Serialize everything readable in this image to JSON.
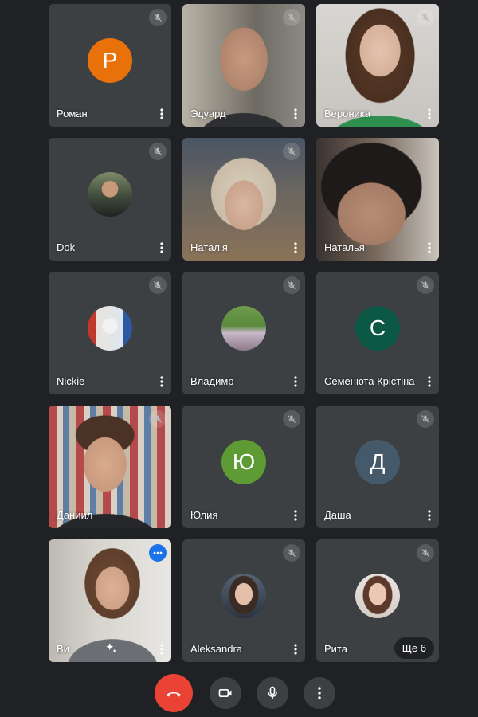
{
  "participants": [
    {
      "name": "Роман",
      "type": "letter",
      "letter": "P",
      "color": "#e8710a",
      "muted": true
    },
    {
      "name": "Эдуард",
      "type": "video",
      "muted": true
    },
    {
      "name": "Вероника",
      "type": "video",
      "muted": true
    },
    {
      "name": "Dok",
      "type": "photo",
      "muted": true
    },
    {
      "name": "Наталія",
      "type": "video",
      "muted": true
    },
    {
      "name": "Наталья",
      "type": "video",
      "muted": false
    },
    {
      "name": "Nickie",
      "type": "photo",
      "muted": true
    },
    {
      "name": "Владимр",
      "type": "photo",
      "muted": true
    },
    {
      "name": "Семенюта Крістіна",
      "type": "letter",
      "letter": "С",
      "color": "#0b5945",
      "muted": true
    },
    {
      "name": "Даниил",
      "type": "video",
      "muted": true
    },
    {
      "name": "Юлия",
      "type": "letter",
      "letter": "Ю",
      "color": "#5f9b35",
      "muted": true
    },
    {
      "name": "Даша",
      "type": "letter",
      "letter": "Д",
      "color": "#445a6a",
      "muted": true
    },
    {
      "name": "Ви",
      "type": "video",
      "muted": false,
      "self": true
    },
    {
      "name": "Aleksandra",
      "type": "photo",
      "muted": true
    },
    {
      "name": "Рита",
      "type": "photo",
      "muted": true,
      "more_label": "Ще 6"
    }
  ],
  "controls": {
    "end_call_color": "#ea4335"
  }
}
